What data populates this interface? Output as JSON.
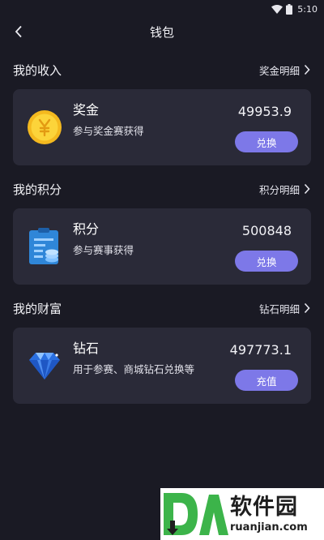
{
  "status_bar": {
    "time": "5:10",
    "icons": [
      "wifi-icon",
      "battery-icon"
    ]
  },
  "header": {
    "title": "钱包",
    "back_icon": "chevron-left-icon"
  },
  "sections": [
    {
      "title": "我的收入",
      "detail_label": "奖金明细",
      "card": {
        "icon": "gold-coin-icon",
        "name": "奖金",
        "desc": "参与奖金赛获得",
        "value": "49953.9",
        "button_label": "兑换"
      }
    },
    {
      "title": "我的积分",
      "detail_label": "积分明细",
      "card": {
        "icon": "clipboard-coins-icon",
        "name": "积分",
        "desc": "参与赛事获得",
        "value": "500848",
        "button_label": "兑换"
      }
    },
    {
      "title": "我的财富",
      "detail_label": "钻石明细",
      "card": {
        "icon": "diamond-icon",
        "name": "钻石",
        "desc": "用于参赛、商城钻石兑换等",
        "value": "497773.1",
        "button_label": "充值"
      }
    }
  ],
  "watermark": {
    "logo_text": "DA",
    "cn": "软件园",
    "en": "ruanjian.com"
  },
  "colors": {
    "background": "#1a1a24",
    "card": "#2a2a38",
    "accent": "#7d78e8"
  }
}
